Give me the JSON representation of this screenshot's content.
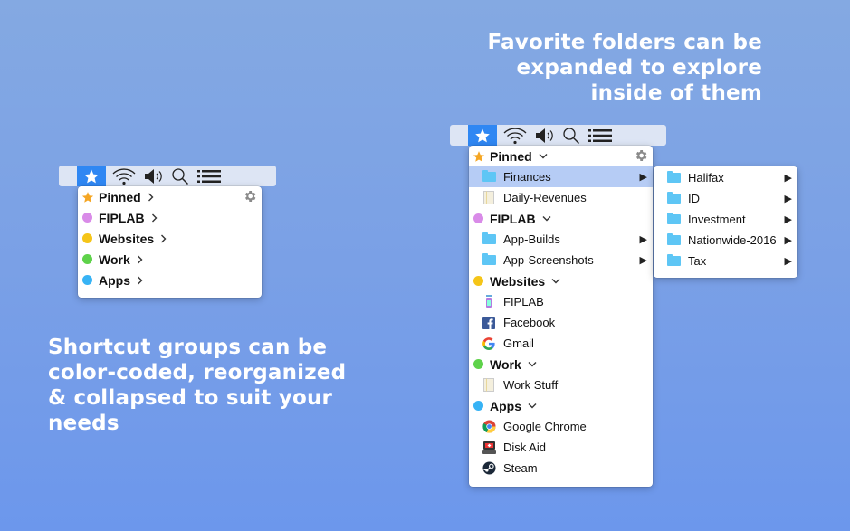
{
  "captions": {
    "right": [
      "Favorite folders can be",
      "expanded to explore",
      "inside of them"
    ],
    "left": [
      "Shortcut groups can be",
      "color-coded, reorganized",
      "& collapsed to suit your",
      "needs"
    ]
  },
  "menubar": {
    "icons": [
      "star-icon",
      "wifi-icon",
      "volume-icon",
      "search-icon",
      "list-icon"
    ],
    "active": "star-icon"
  },
  "colors": {
    "star": "#f5a623",
    "fiplab": "#d98be8",
    "websites": "#f5c518",
    "work": "#5ed24a",
    "apps": "#37b3f5",
    "accent": "#2f87f3",
    "selected_row": "#b6ccf5"
  },
  "collapsed_menu": {
    "groups": [
      {
        "label": "Pinned",
        "icon": "star-icon",
        "chevron": "›"
      },
      {
        "label": "FIPLAB",
        "color": "#d98be8",
        "chevron": "›"
      },
      {
        "label": "Websites",
        "color": "#f5c518",
        "chevron": "›"
      },
      {
        "label": "Work",
        "color": "#5ed24a",
        "chevron": "›"
      },
      {
        "label": "Apps",
        "color": "#37b3f5",
        "chevron": "›"
      }
    ]
  },
  "expanded_menu": {
    "groups": [
      {
        "label": "Pinned",
        "icon": "star-icon",
        "chevron": "⌄",
        "items": [
          {
            "label": "Finances",
            "icon": "folder-icon",
            "submenu": true,
            "selected": true
          },
          {
            "label": "Daily-Revenues",
            "icon": "document-icon",
            "submenu": false
          }
        ]
      },
      {
        "label": "FIPLAB",
        "color": "#d98be8",
        "chevron": "⌄",
        "items": [
          {
            "label": "App-Builds",
            "icon": "folder-icon",
            "submenu": true
          },
          {
            "label": "App-Screenshots",
            "icon": "folder-icon",
            "submenu": true
          }
        ]
      },
      {
        "label": "Websites",
        "color": "#f5c518",
        "chevron": "⌄",
        "items": [
          {
            "label": "FIPLAB",
            "icon": "fiplab-icon"
          },
          {
            "label": "Facebook",
            "icon": "facebook-icon"
          },
          {
            "label": "Gmail",
            "icon": "google-icon"
          }
        ]
      },
      {
        "label": "Work",
        "color": "#5ed24a",
        "chevron": "⌄",
        "items": [
          {
            "label": "Work Stuff",
            "icon": "document-icon"
          }
        ]
      },
      {
        "label": "Apps",
        "color": "#37b3f5",
        "chevron": "⌄",
        "items": [
          {
            "label": "Google Chrome",
            "icon": "chrome-icon"
          },
          {
            "label": "Disk Aid",
            "icon": "diskaid-icon"
          },
          {
            "label": "Steam",
            "icon": "steam-icon"
          }
        ]
      }
    ]
  },
  "submenu": {
    "items": [
      {
        "label": "Halifax"
      },
      {
        "label": "ID"
      },
      {
        "label": "Investment"
      },
      {
        "label": "Nationwide-2016"
      },
      {
        "label": "Tax"
      }
    ],
    "arrow": "▶"
  }
}
